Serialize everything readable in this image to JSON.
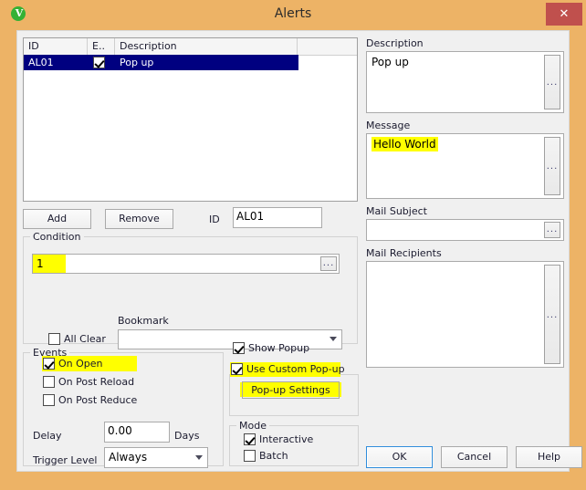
{
  "window": {
    "title": "Alerts",
    "icon_name": "qlikview-logo-icon",
    "icon_letter": "V",
    "close_label": "✕",
    "titlebar_color": "#edb366",
    "close_color": "#c0504d",
    "body_color": "#f0f0f0",
    "highlight_color": "#ffff00",
    "selection_color": "#000080"
  },
  "alert_list": {
    "columns": [
      "ID",
      "E..",
      "Description"
    ],
    "rows": [
      {
        "id": "AL01",
        "enabled": true,
        "description": "Pop up",
        "selected": true
      }
    ]
  },
  "toolbar": {
    "add_label": "Add",
    "remove_label": "Remove",
    "id_label": "ID",
    "id_value": "AL01"
  },
  "condition": {
    "group_label": "Condition",
    "expression_value": "1",
    "expression_highlighted": true,
    "ellipsis_label": "...",
    "all_clear_label": "All Clear",
    "all_clear_checked": false,
    "bookmark_label": "Bookmark",
    "bookmark_value": ""
  },
  "events": {
    "group_label": "Events",
    "checkboxes": [
      {
        "label": "On Open",
        "checked": true,
        "highlighted": true
      },
      {
        "label": "On Post Reload",
        "checked": false,
        "highlighted": false
      },
      {
        "label": "On Post Reduce",
        "checked": false,
        "highlighted": false
      }
    ],
    "delay_label": "Delay",
    "delay_value": "0.00",
    "days_label": "Days",
    "trigger_level_label": "Trigger Level",
    "trigger_level_value": "Always",
    "trigger_level_options": [
      "Always"
    ]
  },
  "popup": {
    "show_popup_label": "Show Popup",
    "show_popup_checked": true,
    "use_custom_label": "Use Custom Pop-up",
    "use_custom_checked": true,
    "settings_button_label": "Pop-up Settings"
  },
  "mode": {
    "group_label": "Mode",
    "interactive_label": "Interactive",
    "interactive_checked": true,
    "batch_label": "Batch",
    "batch_checked": false
  },
  "right_panel": {
    "description_label": "Description",
    "description_value": "Pop up",
    "message_label": "Message",
    "message_value": "Hello World",
    "message_highlighted": true,
    "mail_subject_label": "Mail Subject",
    "mail_subject_value": "",
    "mail_recipients_label": "Mail Recipients",
    "mail_recipients_value": "",
    "ellipsis_label": "..."
  },
  "footer": {
    "ok_label": "OK",
    "cancel_label": "Cancel",
    "help_label": "Help"
  }
}
